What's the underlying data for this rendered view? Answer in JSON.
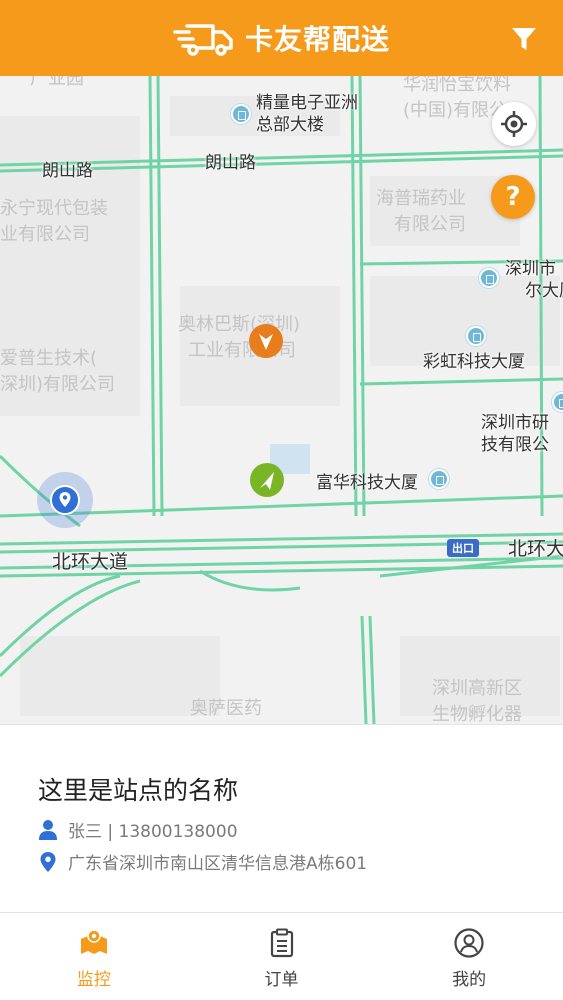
{
  "header": {
    "title": "卡友帮配送",
    "logo_icon": "truck-icon",
    "filter_icon": "filter-icon",
    "bg_color": "#f59a1b"
  },
  "map": {
    "roads": {
      "langshan_left": "朗山路",
      "langshan_mid": "朗山路",
      "beihuan_left": "北环大道",
      "beihuan_right": "北环大"
    },
    "pois": {
      "jingliang_1": "精量电子亚洲",
      "jingliang_2": "总部大楼",
      "huarun_1": "华润怡宝饮料",
      "huarun_2": "(中国)有限公",
      "haipurui_1": "海普瑞药业",
      "haipurui_2": "有限公司",
      "yongning_1": "永宁现代包装",
      "yongning_2": "业有限公司",
      "shenzhenshi_1": "深圳市",
      "shenzhenshi_2": "尔大厦",
      "olympus_1": "奥林巴斯(深圳)",
      "olympus_2": "工业有限公司",
      "aipu_1": "爱普生技术(",
      "aipu_2": "深圳)有限公司",
      "caihong": "彩虹科技大厦",
      "yanji_1": "深圳市研",
      "yanji_2": "技有限公",
      "fuhua": "富华科技大厦",
      "aosa": "奥萨医药",
      "gaoxin_1": "深圳高新区",
      "gaoxin_2": "生物孵化器",
      "guangye": "广业园"
    },
    "exit_badge": "出口",
    "help_label": "?",
    "road_color": "#6fd3a6",
    "marker_orange": "#e87d1e",
    "marker_green": "#7ab527",
    "my_location_color": "#2f6fd6"
  },
  "station": {
    "name": "这里是站点的名称",
    "contact": "张三 | 13800138000",
    "address": "广东省深圳市南山区清华信息港A栋601"
  },
  "tabs": [
    {
      "label": "监控",
      "icon": "map-monitor-icon",
      "active": true
    },
    {
      "label": "订单",
      "icon": "clipboard-icon",
      "active": false
    },
    {
      "label": "我的",
      "icon": "user-icon",
      "active": false
    }
  ]
}
